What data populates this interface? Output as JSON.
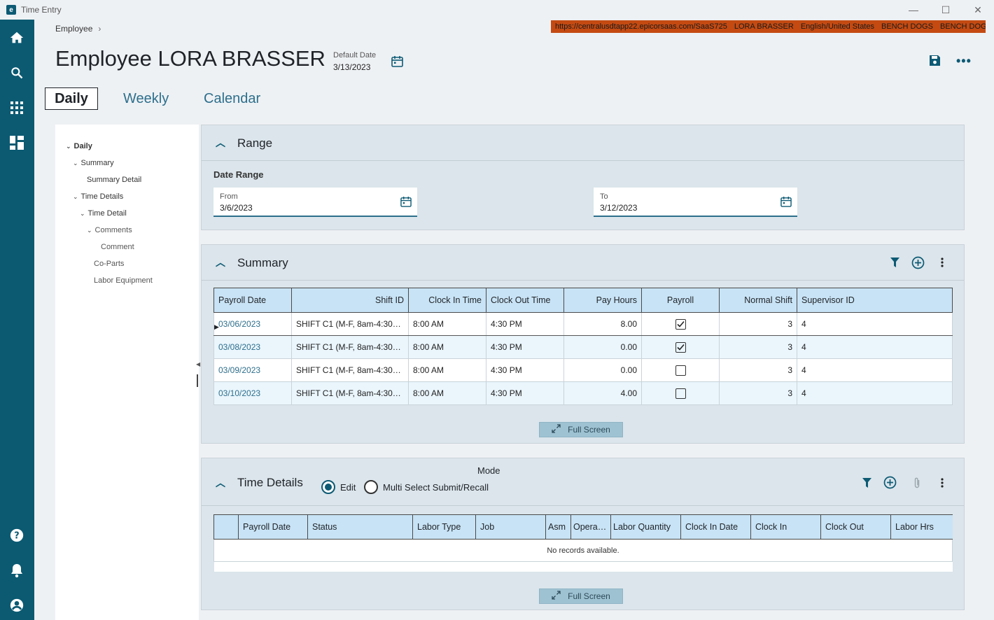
{
  "window": {
    "title": "Time Entry",
    "minimize": "—",
    "maximize": "☐",
    "close": "✕"
  },
  "infobar": {
    "url": "https://centralusdtapp22.epicorsaas.com/SaaS725",
    "user": "LORA BRASSER",
    "locale": "English/United States",
    "company": "BENCH DOGS",
    "site": "BENCH DOGS"
  },
  "breadcrumb": {
    "item": "Employee",
    "chevron": "›"
  },
  "header": {
    "title": "Employee LORA BRASSER",
    "default_date_label": "Default Date",
    "default_date_value": "3/13/2023"
  },
  "tabs": [
    {
      "label": "Daily"
    },
    {
      "label": "Weekly"
    },
    {
      "label": "Calendar"
    }
  ],
  "tree": [
    {
      "label": "Daily"
    },
    {
      "label": "Summary"
    },
    {
      "label": "Summary Detail"
    },
    {
      "label": "Time Details"
    },
    {
      "label": "Time Detail"
    },
    {
      "label": "Comments"
    },
    {
      "label": "Comment"
    },
    {
      "label": "Co-Parts"
    },
    {
      "label": "Labor Equipment"
    }
  ],
  "range": {
    "title": "Range",
    "date_range_label": "Date Range",
    "from_label": "From",
    "from_value": "3/6/2023",
    "to_label": "To",
    "to_value": "3/12/2023"
  },
  "summary": {
    "title": "Summary",
    "columns": [
      "Payroll Date",
      "Shift ID",
      "Clock In Time",
      "Clock Out Time",
      "Pay Hours",
      "Payroll",
      "Normal Shift",
      "Supervisor ID"
    ],
    "rows": [
      {
        "payroll_date": "03/06/2023",
        "shift_id": "SHIFT C1 (M-F, 8am-4:30…",
        "clock_in": "8:00 AM",
        "clock_out": "4:30 PM",
        "pay_hours": "8.00",
        "payroll": true,
        "normal_shift": "3",
        "supervisor_id": "4"
      },
      {
        "payroll_date": "03/08/2023",
        "shift_id": "SHIFT C1 (M-F, 8am-4:30…",
        "clock_in": "8:00 AM",
        "clock_out": "4:30 PM",
        "pay_hours": "0.00",
        "payroll": true,
        "normal_shift": "3",
        "supervisor_id": "4"
      },
      {
        "payroll_date": "03/09/2023",
        "shift_id": "SHIFT C1 (M-F, 8am-4:30…",
        "clock_in": "8:00 AM",
        "clock_out": "4:30 PM",
        "pay_hours": "0.00",
        "payroll": false,
        "normal_shift": "3",
        "supervisor_id": "4"
      },
      {
        "payroll_date": "03/10/2023",
        "shift_id": "SHIFT C1 (M-F, 8am-4:30…",
        "clock_in": "8:00 AM",
        "clock_out": "4:30 PM",
        "pay_hours": "4.00",
        "payroll": false,
        "normal_shift": "3",
        "supervisor_id": "4"
      }
    ],
    "full_screen_label": "Full Screen"
  },
  "time_details": {
    "title": "Time Details",
    "mode_label": "Mode",
    "mode_options": [
      {
        "label": "Edit",
        "selected": true
      },
      {
        "label": "Multi Select Submit/Recall",
        "selected": false
      }
    ],
    "columns": [
      "",
      "Payroll Date",
      "Status",
      "Labor Type",
      "Job",
      "Asm",
      "Opera…",
      "Labor Quantity",
      "Clock In Date",
      "Clock In",
      "Clock Out",
      "Labor Hrs"
    ],
    "empty_text": "No records available.",
    "full_screen_label": "Full Screen"
  },
  "colors": {
    "rail": "#0b5a72",
    "accent": "#2d6f8c",
    "infobar": "#c44a12",
    "grid_header": "#c8e3f5",
    "panel": "#dbe5eb"
  },
  "icons": {
    "rail": [
      "home-icon",
      "search-icon",
      "apps-grid-icon",
      "dashboard-icon",
      "help-icon",
      "bell-icon",
      "user-icon"
    ],
    "header": [
      "calendar-icon",
      "save-icon",
      "more-icon"
    ],
    "grid_toolbar": [
      "filter-icon",
      "add-icon",
      "kebab-icon",
      "attachment-icon"
    ]
  }
}
